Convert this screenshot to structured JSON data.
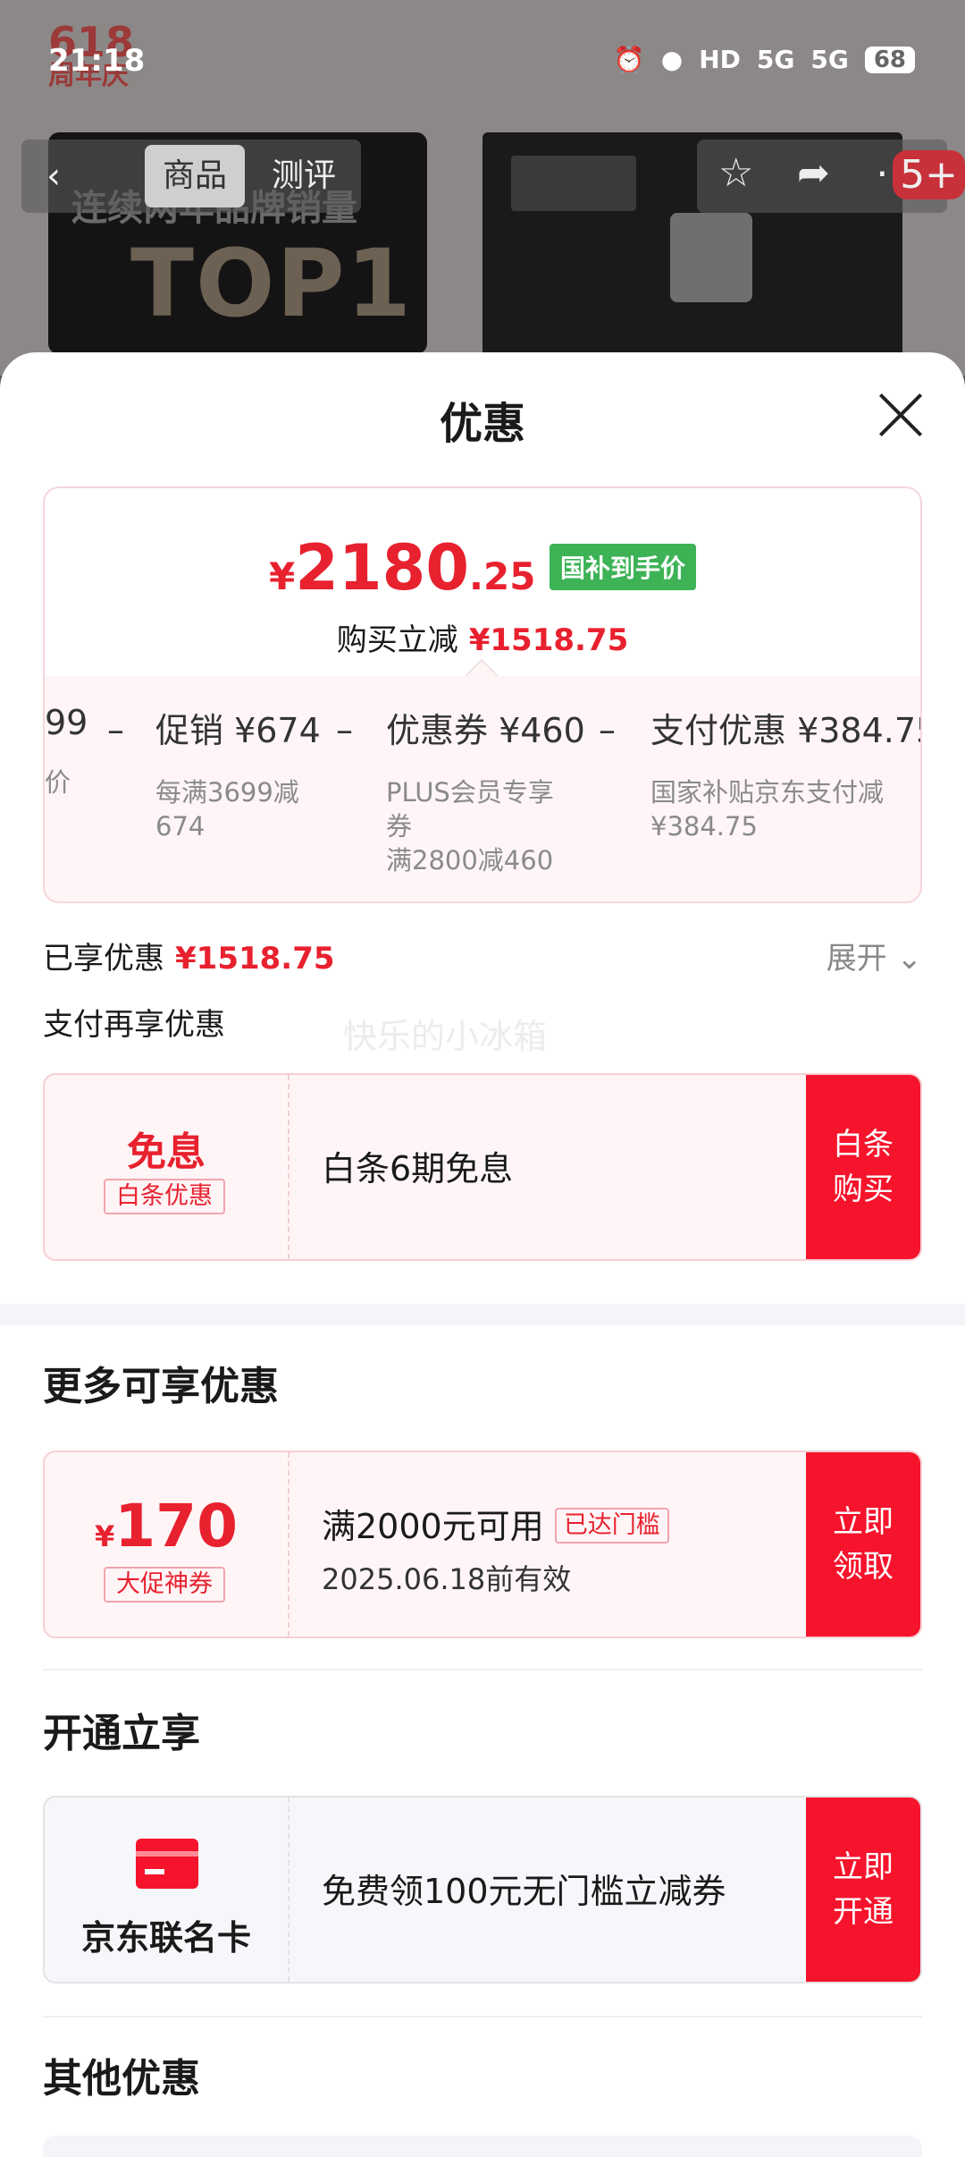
{
  "status_bar": {
    "time": "21:18",
    "icons": [
      "alarm-icon",
      "location-icon",
      "hd-icon",
      "5g-signal-icon",
      "5g-signal-icon"
    ],
    "hd_label": "HD",
    "signal1": "5G",
    "signal2": "5G",
    "battery": "68"
  },
  "background_page": {
    "logo_top": "618",
    "logo_bottom": "周年庆",
    "tabs": [
      "商品",
      "测评"
    ],
    "poster_line1": "连续两年品牌销量",
    "poster_line2": "TOP1",
    "cart_badge": "5+"
  },
  "sheet": {
    "title": "优惠",
    "summary": {
      "currency": "¥",
      "price_int": "2180",
      "price_dec": ".25",
      "badge": "国补到手价",
      "reduce_label": "购买立减",
      "reduce_amount": "¥1518.75"
    },
    "breakdown": [
      {
        "title": "99",
        "desc": "价"
      },
      {
        "title": "促销 ¥674",
        "desc": "每满3699减\n674"
      },
      {
        "title": "优惠券 ¥460",
        "desc": "PLUS会员专享\n券\n满2800减460"
      },
      {
        "title": "支付优惠 ¥384.75",
        "desc": "国家补贴京东支付减\n¥384.75"
      }
    ],
    "minus_sign": "–",
    "enjoyed_label": "已享优惠",
    "enjoyed_amount": "¥1518.75",
    "expand_label": "展开",
    "pay_again_label": "支付再享优惠",
    "watermark": "快乐的小冰箱",
    "baitiao": {
      "left_main": "免息",
      "left_tag": "白条优惠",
      "text": "白条6期免息",
      "action_line1": "白条",
      "action_line2": "购买"
    },
    "more_title": "更多可享优惠",
    "coupon": {
      "currency": "¥",
      "amount": "170",
      "tag": "大促神券",
      "condition": "满2000元可用",
      "threshold_badge": "已达门槛",
      "validity": "2025.06.18前有效",
      "action_line1": "立即",
      "action_line2": "领取"
    },
    "open_title": "开通立享",
    "jd_card": {
      "name": "京东联名卡",
      "text": "免费领100元无门槛立减券",
      "action_line1": "立即",
      "action_line2": "开通"
    },
    "other_title": "其他优惠"
  },
  "colors": {
    "accent_red": "#e8212f",
    "action_red": "#f5142c",
    "green_badge": "#3db356"
  }
}
